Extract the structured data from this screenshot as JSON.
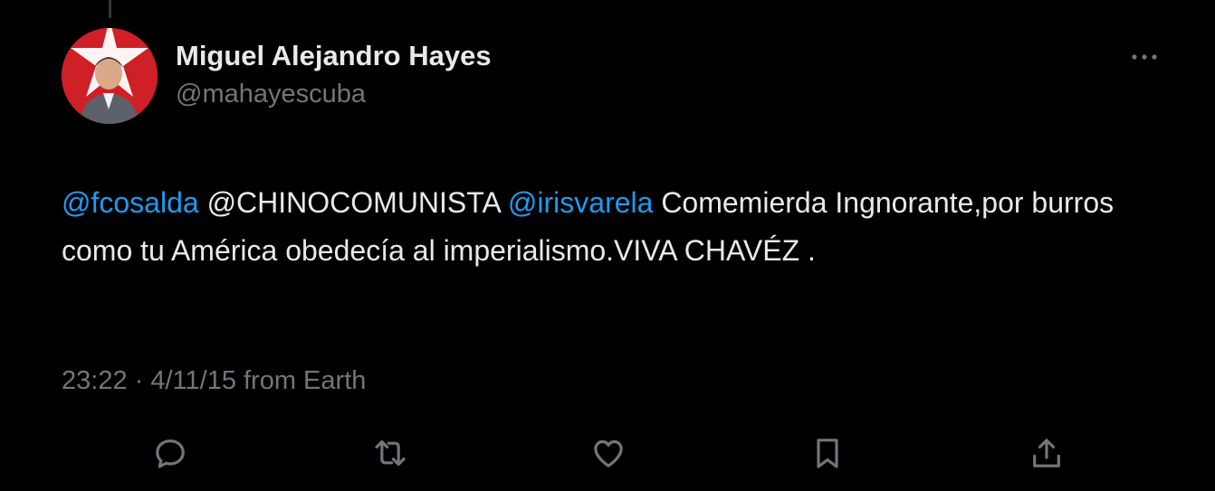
{
  "author": {
    "name": "Miguel Alejandro Hayes",
    "handle": "@mahayescuba"
  },
  "tweet": {
    "mention_1": "@fcosalda",
    "plain_1": " @CHINOCOMUNISTA ",
    "mention_2": "@irisvarela",
    "plain_2": " Comemierda Ingnorante,por burros como tu América obedecía al imperialismo.VIVA CHAVÉZ ."
  },
  "meta": {
    "timestamp": "23:22 · 4/11/15 from Earth"
  },
  "icons": {
    "more": "more-horizontal-icon",
    "reply": "reply-icon",
    "retweet": "retweet-icon",
    "like": "heart-icon",
    "bookmark": "bookmark-icon",
    "share": "share-icon"
  },
  "colors": {
    "background": "#000000",
    "text": "#e7e9ea",
    "secondary": "#71767b",
    "link": "#1d9bf0",
    "avatar_red": "#cf2027"
  }
}
